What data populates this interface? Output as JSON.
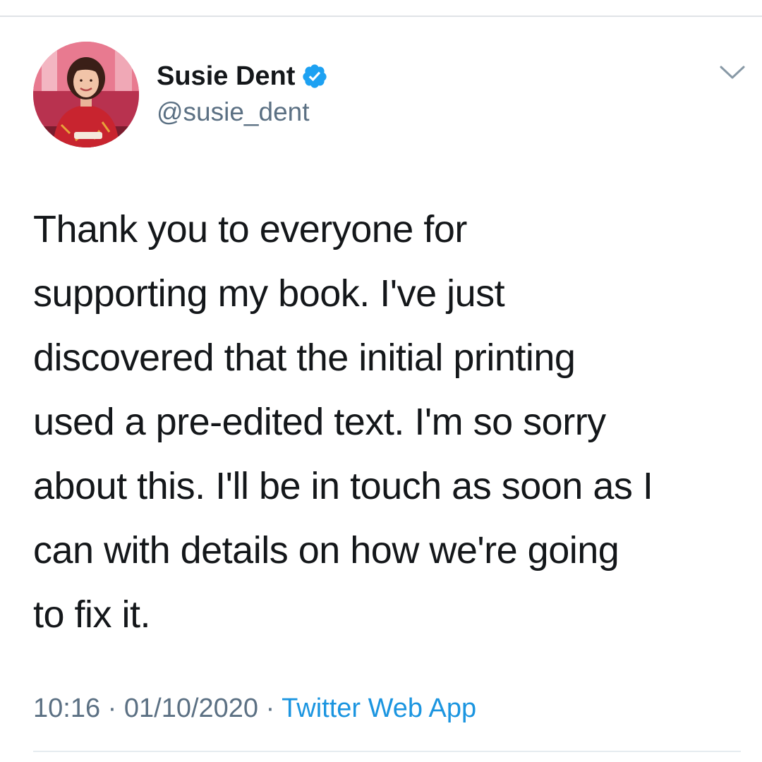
{
  "tweet": {
    "author": {
      "display_name": "Susie Dent",
      "handle": "@susie_dent",
      "verified": true,
      "avatar_icon": "profile-photo"
    },
    "text": "Thank you to everyone for\nsupporting my book. I've just\ndiscovered that the initial printing\nused a pre-edited text. I'm so sorry\nabout this. I'll be in touch as soon as I\ncan with details on how we're going\nto fix it.",
    "time": "10:16",
    "separator": "·",
    "date": "01/10/2020",
    "source": "Twitter Web App",
    "menu_icon": "chevron-down-icon"
  },
  "colors": {
    "verified_badge": "#1da1f2",
    "link": "#1b95e0",
    "secondary_text": "#5b7083",
    "primary_text": "#14171a"
  }
}
